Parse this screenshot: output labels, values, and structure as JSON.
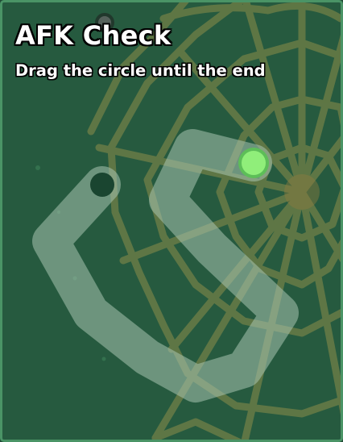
{
  "dialog": {
    "title": "AFK Check",
    "instruction": "Drag the circle until the end"
  },
  "colors": {
    "background": "#265a3f",
    "border": "#4a9466",
    "track": "#a8c4b0",
    "cobweb": "#b3a04e",
    "handle": "#90ee7a",
    "handle_ring": "#5dbe58",
    "end_marker": "#1a4530"
  },
  "icons": {
    "handle": "drag-handle-circle",
    "end_marker": "path-end-icon",
    "decoration": "cobweb-icon"
  }
}
